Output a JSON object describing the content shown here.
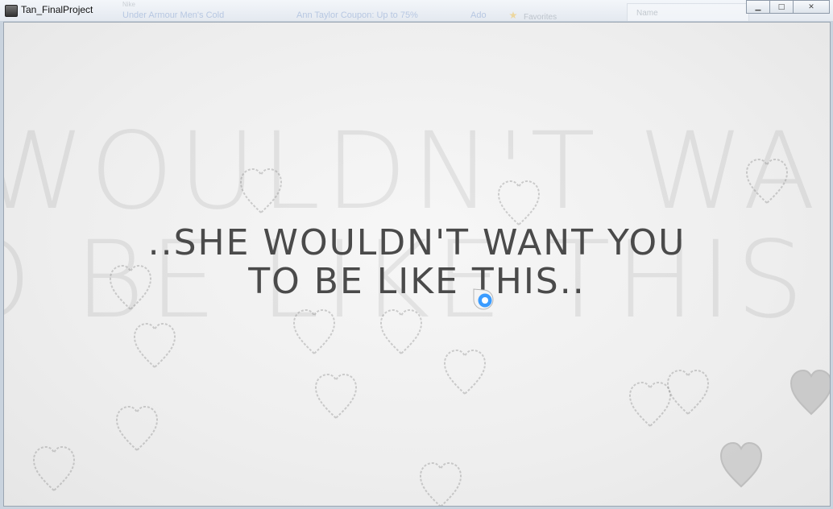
{
  "window": {
    "title": "Tan_FinalProject",
    "buttons": [
      "minimize",
      "maximize",
      "close"
    ]
  },
  "background_glimpses": {
    "link1": "Under Armour Men's Cold",
    "link2": "Ann Taylor Coupon: Up to 75%",
    "link3": "Ado",
    "favorites_label": "Favorites",
    "name_label": "Name"
  },
  "game": {
    "background_text_line1": "WOULDN'T WAN",
    "background_text_line2": "O BE LIKE THIS",
    "message_line1": "..SHE WOULDN'T WANT YOU",
    "message_line2": "TO BE LIKE THIS..",
    "text_color": "#4a4a4a",
    "cursor_color": "#3b9cff"
  }
}
